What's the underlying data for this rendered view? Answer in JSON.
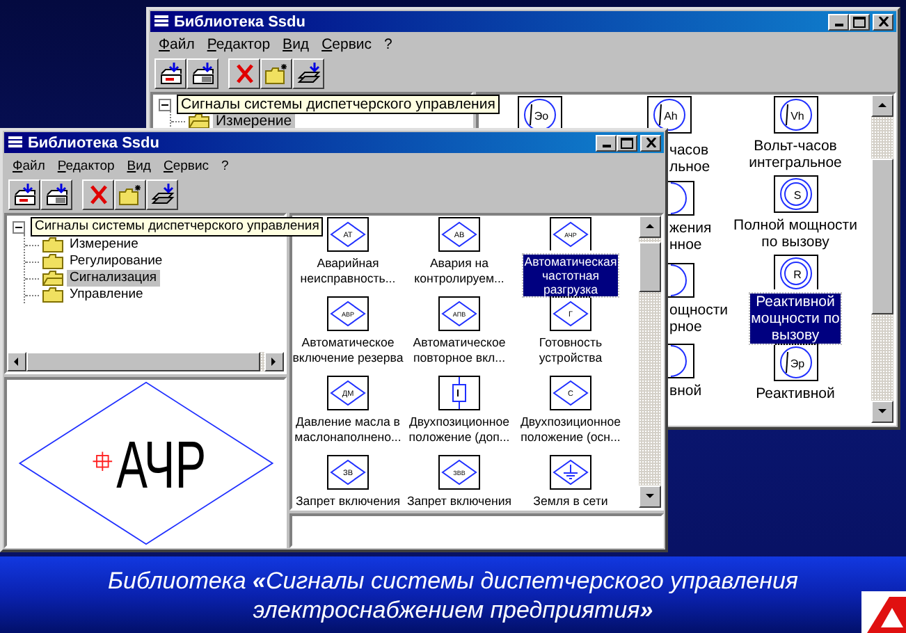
{
  "back_window": {
    "title": "Библиотека Ssdu",
    "menu": [
      "Файл",
      "Редактор",
      "Вид",
      "Сервис",
      "?"
    ],
    "tree": {
      "label": "Сигналы системы диспетчерского управления",
      "expanded": true,
      "children": [
        {
          "label": "Измерение",
          "selected": true
        }
      ]
    },
    "icon_columns": [
      [
        {
          "kind": "circle",
          "symbol": "Эо"
        }
      ],
      [
        {
          "kind": "cut",
          "symbol": "Ah",
          "label": "часов\nльное",
          "selected": false
        },
        {
          "kind": "cut",
          "label": "жения\nнное",
          "selected": false
        },
        {
          "kind": "cut",
          "label": "ощности\nрное",
          "selected": false
        },
        {
          "kind": "cut",
          "label": "вной",
          "selected": false
        }
      ],
      [
        {
          "kind": "circle",
          "symbol": "Vh",
          "label": "Вольт-часов\nинтегральное",
          "selected": false
        },
        {
          "kind": "double-circle",
          "symbol": "S",
          "label": "Полной мощности\nпо вызову",
          "selected": false
        },
        {
          "kind": "double-circle",
          "symbol": "R",
          "label": "Реактивной\nмощности по\nвызову",
          "selected": true
        },
        {
          "kind": "circle",
          "symbol": "Эр",
          "label": "Реактивной",
          "selected": false
        }
      ]
    ]
  },
  "front_window": {
    "title": "Библиотека Ssdu",
    "menu": [
      "Файл",
      "Редактор",
      "Вид",
      "Сервис",
      "?"
    ],
    "tree": {
      "label": "Сигналы системы диспетчерского управления",
      "expanded": true,
      "children": [
        {
          "label": "Измерение",
          "selected": false
        },
        {
          "label": "Регулирование",
          "selected": false
        },
        {
          "label": "Сигнализация",
          "selected": true
        },
        {
          "label": "Управление",
          "selected": false
        }
      ]
    },
    "icons": [
      {
        "kind": "diamond",
        "symbol": "АТ",
        "label": "Аварийная\nнеисправность...",
        "selected": false
      },
      {
        "kind": "diamond",
        "symbol": "АВ",
        "label": "Авария на\nконтролируем...",
        "selected": false
      },
      {
        "kind": "diamond",
        "symbol": "АЧР",
        "label": "Автоматическая\nчастотная\nразгрузка",
        "selected": true
      },
      {
        "kind": "diamond",
        "symbol": "АВР",
        "label": "Автоматическое\nвключение резерва",
        "selected": false
      },
      {
        "kind": "diamond",
        "symbol": "АПВ",
        "label": "Автоматическое\nповторное вкл...",
        "selected": false
      },
      {
        "kind": "diamond",
        "symbol": "Г",
        "label": "Готовность\nустройства",
        "selected": false
      },
      {
        "kind": "diamond",
        "symbol": "ДМ",
        "label": "Давление масла в\nмаслонаполнено...",
        "selected": false
      },
      {
        "kind": "contact",
        "label": "Двухпозиционное\nположение (доп...",
        "selected": false
      },
      {
        "kind": "diamond",
        "symbol": "С",
        "label": "Двухпозиционное\nположение (осн...",
        "selected": false
      },
      {
        "kind": "diamond",
        "symbol": "ЗВ",
        "label": "Запрет включения",
        "selected": false
      },
      {
        "kind": "diamond",
        "symbol": "ЗВВ",
        "label": "Запрет включения",
        "selected": false
      },
      {
        "kind": "ground",
        "label": "Земля в сети",
        "selected": false
      }
    ],
    "preview": {
      "symbol": "АЧР"
    }
  },
  "caption": "Библиотека **«**Сигналы системы диспетчерского управления электроснабжением предприятия**»**"
}
